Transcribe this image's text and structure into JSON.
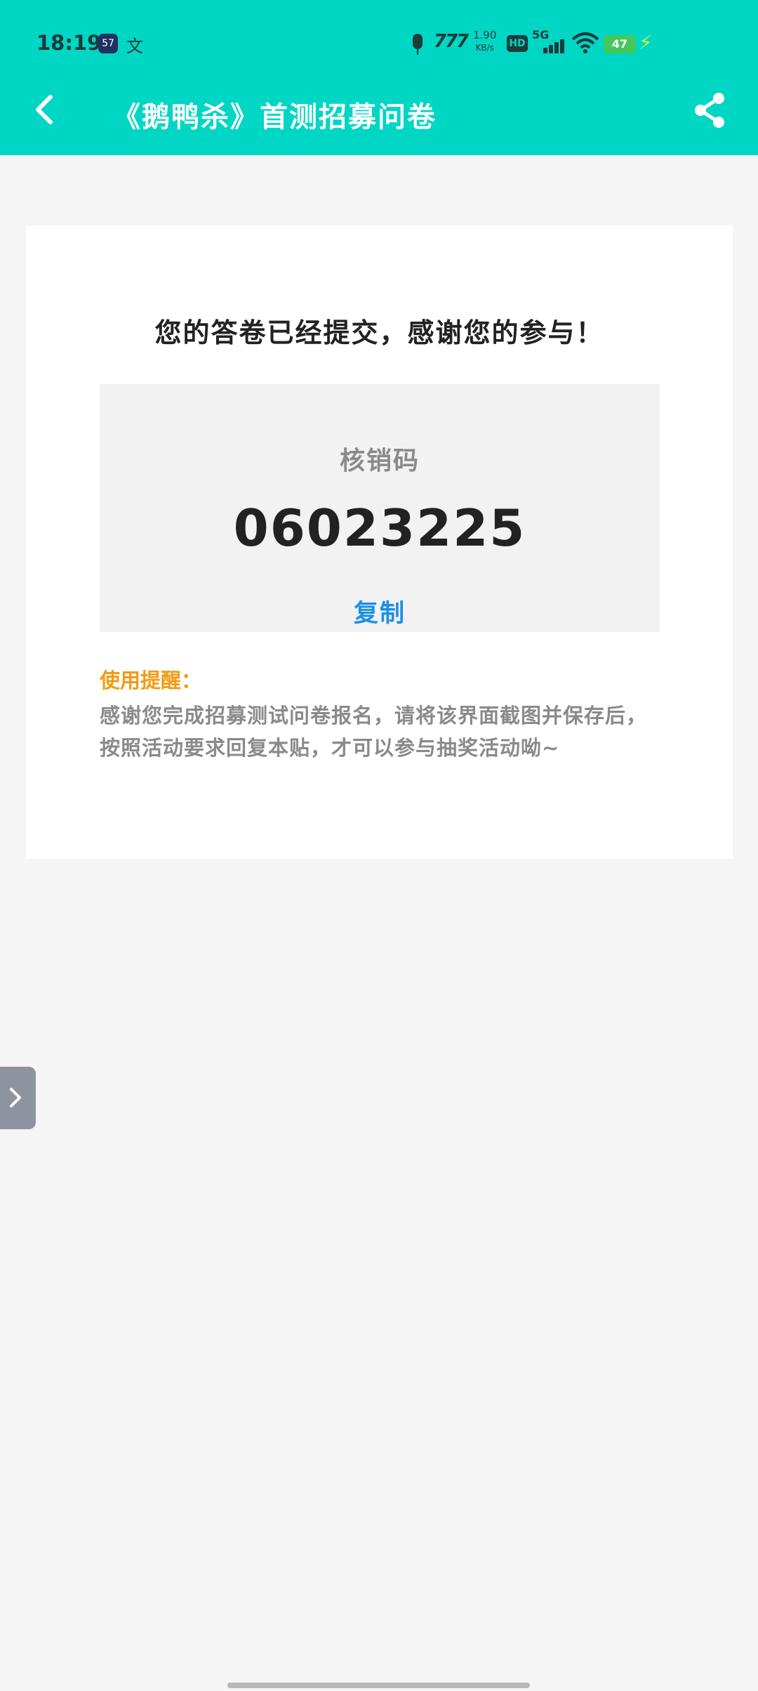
{
  "status_bar": {
    "time": "18:19",
    "app_icon_label": "57",
    "translate_glyph": "文",
    "vpn_label": "777",
    "net_speed_value": "1.90",
    "net_speed_unit": "KB/s",
    "hd_label": "HD",
    "network_label": "5G",
    "battery_level": "47"
  },
  "header": {
    "title": "《鹅鸭杀》首测招募问卷"
  },
  "result": {
    "message": "您的答卷已经提交，感谢您的参与！",
    "code_label": "核销码",
    "code_value": "06023225",
    "copy_label": "复制"
  },
  "tip": {
    "heading": "使用提醒：",
    "body": "感谢您完成招募测试问卷报名，请将该界面截图并保存后，按照活动要求回复本贴，才可以参与抽奖活动呦~"
  },
  "colors": {
    "header_bg": "#00d6c4",
    "accent_blue": "#1a90e6",
    "tip_orange": "#f39a12"
  },
  "icons": {
    "back": "chevron-left-icon",
    "share": "share-icon",
    "side_handle": "chevron-right-icon"
  }
}
